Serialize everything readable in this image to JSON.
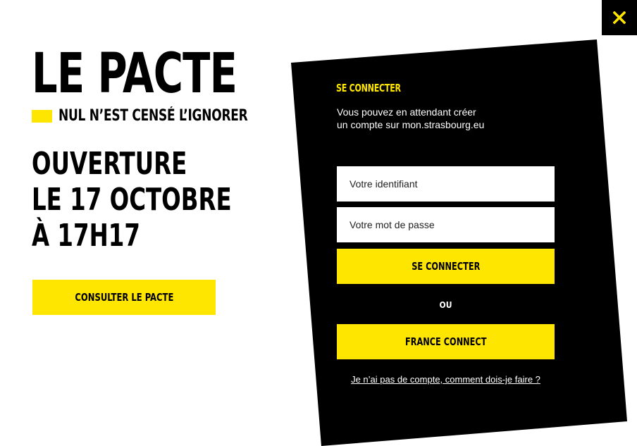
{
  "close": {
    "label": "Close",
    "icon": "close-icon"
  },
  "logo": {
    "title": "LE PACTE",
    "subtitle": "NUL N’EST CENSÉ L’IGNORER"
  },
  "announcement": {
    "line1": "OUVERTURE",
    "line2": "LE 17 OCTOBRE",
    "line3": "À 17H17"
  },
  "consult_button": "CONSULTER LE PACTE",
  "login": {
    "title": "SE CONNECTER",
    "description_line1": "Vous pouvez en attendant créer",
    "description_line2": "un compte sur mon.strasbourg.eu",
    "username_placeholder": "Votre identifiant",
    "password_placeholder": "Votre mot de passe",
    "submit_label": "SE CONNECTER",
    "or_label": "OU",
    "france_connect_label": "FRANCE CONNECT",
    "help_link": "Je n’ai pas de compte, comment dois-je faire ?"
  },
  "colors": {
    "accent": "#ffe600",
    "panel": "#000000",
    "background": "#ffffff"
  }
}
